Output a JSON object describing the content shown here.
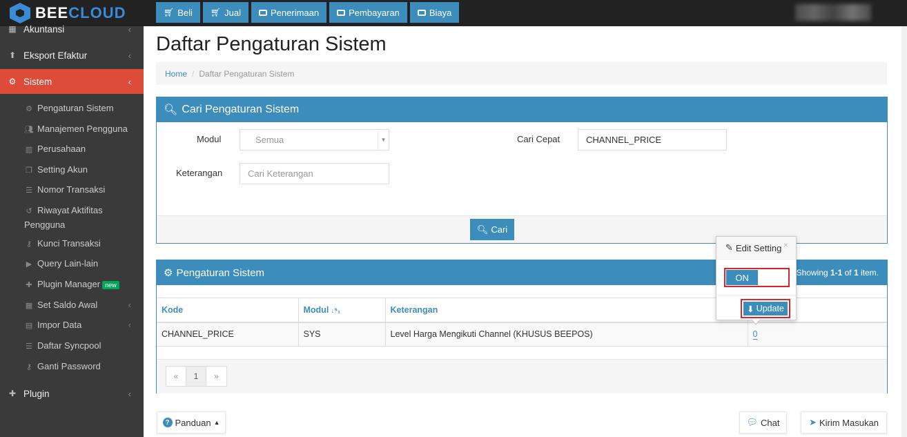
{
  "brand": {
    "name_part1": "BEE",
    "name_part2": "CLOUD"
  },
  "topnav": [
    {
      "label": "Beli",
      "icon": "cart-icon"
    },
    {
      "label": "Jual",
      "icon": "cart-icon"
    },
    {
      "label": "Penerimaan",
      "icon": "money-icon"
    },
    {
      "label": "Pembayaran",
      "icon": "money-icon"
    },
    {
      "label": "Biaya",
      "icon": "money-icon"
    }
  ],
  "sidebar": {
    "items": [
      {
        "label": "Akuntansi",
        "icon": "calculator-icon"
      },
      {
        "label": "Eksport Efaktur",
        "icon": "upload-icon"
      },
      {
        "label": "Sistem",
        "icon": "gears-icon"
      },
      {
        "label": "Plugin",
        "icon": "puzzle-icon"
      }
    ],
    "sub_items": [
      {
        "label": "Pengaturan Sistem"
      },
      {
        "label": "Manajemen Pengguna"
      },
      {
        "label": "Perusahaan"
      },
      {
        "label": "Setting Akun"
      },
      {
        "label": "Nomor Transaksi"
      },
      {
        "label": "Riwayat Aktifitas Pengguna"
      },
      {
        "label": "Kunci Transaksi"
      },
      {
        "label": "Query Lain-lain"
      },
      {
        "label": "Plugin Manager",
        "badge": "new"
      },
      {
        "label": "Set Saldo Awal"
      },
      {
        "label": "Impor Data"
      },
      {
        "label": "Daftar Syncpool"
      },
      {
        "label": "Ganti Password"
      }
    ]
  },
  "page": {
    "title": "Daftar Pengaturan Sistem",
    "breadcrumb": {
      "home": "Home",
      "current": "Daftar Pengaturan Sistem"
    }
  },
  "search": {
    "title": "Cari Pengaturan Sistem",
    "modul_label": "Modul",
    "modul_value": "Semua",
    "keterangan_label": "Keterangan",
    "keterangan_placeholder": "Cari Keterangan",
    "quick_label": "Cari Cepat",
    "quick_value": "CHANNEL_PRICE",
    "button": "Cari"
  },
  "results": {
    "title": "Pengaturan Sistem",
    "showing_prefix": "Showing ",
    "showing_range": "1-1",
    "showing_mid": " of ",
    "showing_total": "1",
    "showing_suffix": " item.",
    "columns": [
      "Kode",
      "Modul",
      "Keterangan"
    ],
    "rows": [
      {
        "kode": "CHANNEL_PRICE",
        "modul": "SYS",
        "keterangan": "Level Harga Mengikuti Channel (KHUSUS BEEPOS)",
        "value": "0"
      }
    ],
    "pager": {
      "prev": "«",
      "page": "1",
      "next": "»"
    }
  },
  "popover": {
    "title": "Edit Setting",
    "close": "×",
    "toggle_label": "ON",
    "update": "Update"
  },
  "footer": {
    "panduan": "Panduan",
    "chat": "Chat",
    "kirim": "Kirim Masukan"
  },
  "colors": {
    "primary": "#3c8dbc",
    "active": "#dd4b39",
    "sidebar": "#3a3a3a",
    "highlight": "#d9232d"
  }
}
